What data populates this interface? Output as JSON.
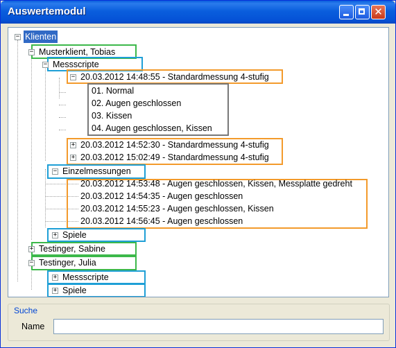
{
  "window": {
    "title": "Auswertemodul",
    "close_glyph": "✕"
  },
  "tree": {
    "root": "Klienten",
    "client1": "Musterklient, Tobias",
    "messscripte1": "Messscripte",
    "session1": "20.03.2012 14:48:55 - Standardmessung 4-stufig",
    "steps": [
      "01. Normal",
      "02. Augen geschlossen",
      "03. Kissen",
      "04. Augen geschlossen, Kissen"
    ],
    "session2": "20.03.2012 14:52:30 - Standardmessung 4-stufig",
    "session3": "20.03.2012 15:02:49 - Standardmessung 4-stufig",
    "einzel": "Einzelmessungen",
    "singles": [
      "20.03.2012 14:53:48 - Augen geschlossen, Kissen, Messplatte gedreht",
      "20.03.2012 14:54:35 - Augen geschlossen",
      "20.03.2012 14:55:23 - Augen geschlossen, Kissen",
      "20.03.2012 14:56:45 - Augen geschlossen"
    ],
    "spiele1": "Spiele",
    "client2": "Testinger, Sabine",
    "client3": "Testinger, Julia",
    "messscripte3": "Messscripte",
    "spiele3": "Spiele",
    "expanded_glyph": "−",
    "collapsed_glyph": "+"
  },
  "search": {
    "group_title": "Suche",
    "name_label": "Name",
    "name_value": ""
  },
  "colors": {
    "client_box": "#3CB84A",
    "category_box": "#1E9FD6",
    "session_box": "#F39A2B",
    "steps_box": "#777777",
    "selection": "#316AC5"
  }
}
